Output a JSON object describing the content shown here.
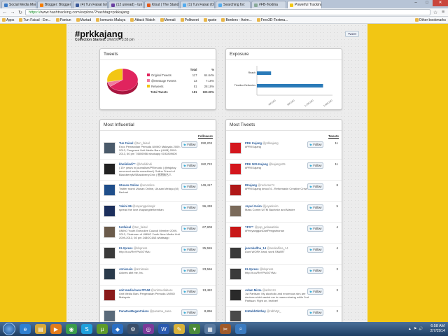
{
  "browser": {
    "tabs": [
      {
        "label": "Social Media Mon",
        "color": "#3b79c4",
        "active": false
      },
      {
        "label": "Blogger: Blogger",
        "color": "#f57d00",
        "active": false
      },
      {
        "label": "(4) Tun Faisal Isma",
        "color": "#3b5998",
        "active": false
      },
      {
        "label": "(12 unread) - tun",
        "color": "#6a3fa0",
        "active": false
      },
      {
        "label": "Klout | The Standa",
        "color": "#e25a1c",
        "active": false
      },
      {
        "label": "(1) Tun Faisal (Or",
        "color": "#55acee",
        "active": false
      },
      {
        "label": "Searching for:",
        "color": "#55acee",
        "active": false
      },
      {
        "label": "#FB-Textma",
        "color": "#8a9",
        "active": false
      },
      {
        "label": "Powerful Tracking",
        "color": "#f2c614",
        "active": true
      }
    ],
    "url_scheme": "https://",
    "url_rest": "www.hashtracking.com/explore/?hashtag=prkkajang",
    "bookmarks": [
      "Apps",
      "Tun Faisal - Em...",
      "Pantun",
      "Murtad",
      "komunis Malaya",
      "Attack Watch",
      "Memali",
      "Politweet",
      "quote",
      "Borders - Anim...",
      "Free3D-Textma..."
    ],
    "other_bookmarks": "Other bookmarks"
  },
  "page": {
    "title": "#prkkajang",
    "collection_label": "Collection Started:",
    "collection_value": "2/6/2014 3:33 pm",
    "tweet_button": "Tweet"
  },
  "tweets_panel": {
    "title": "Tweets",
    "col_total": "Total",
    "col_pct": "%",
    "rows": [
      {
        "label": "Original Tweets",
        "total": "117",
        "pct": "64.64%",
        "color": "#e0245e"
      },
      {
        "label": "@Message Tweets",
        "total": "13",
        "pct": "7.18%",
        "color": "#f07aa0"
      },
      {
        "label": "Retweets",
        "total": "51",
        "pct": "28.18%",
        "color": "#f2c614"
      }
    ],
    "total_label": "Total Tweets",
    "total_value": "181",
    "total_pct": "100.00%"
  },
  "exposure_panel": {
    "title": "Exposure",
    "chart_data": {
      "type": "bar",
      "orientation": "horizontal",
      "categories": [
        "Reach",
        "Timeline Deliveries"
      ],
      "values": [
        300000,
        1400000
      ],
      "tick_labels": [
        "400,000",
        "800,000",
        "1,200,000",
        "1,600,000"
      ],
      "xlim": [
        0,
        1600000
      ],
      "color": "#2a7ab8"
    }
  },
  "influential_panel": {
    "title": "Most Influential",
    "col_label": "Followers",
    "follow_label": "Follow",
    "rows": [
      {
        "name": "Tun Faisal",
        "handle": "@tun_faisal",
        "bio": "Exco Pemandian Pemuda UMNO Malaysia 2009-2013, Pengerusi Unit Media Baru (UMB) 2009-2013, 60 pm 74506956 whatsapp 0192809600",
        "value": "290,203",
        "avatar": "#4a5a6a"
      },
      {
        "name": "kholidindi™",
        "handle": "@kholidindi",
        "bio": "| 15+ years in journalism/PR/music | @rtsjstay servernet media consultant | Online Friend of BlackberryMSBlackberryChix | 香港無名人",
        "value": "182,722",
        "avatar": "#222222"
      },
      {
        "name": "Utusan Online",
        "handle": "@umonline",
        "bio": "Twitter rasmi Utusan Online, Utusan Melayu (M) Berhad",
        "value": "149,417",
        "avatar": "#1f4e8a"
      },
      {
        "name": "Yakini 86",
        "handle": "@sayangpelangir",
        "bio": "spread the love #sayangberkemban",
        "value": "96,438",
        "avatar": "#1c2f5c"
      },
      {
        "name": "tunfaisal",
        "handle": "@tun_faisal",
        "bio": "UMNO Youth Executive Council Member 2009-2013, Chairman of UMNO Youth New Media Unit 2009-2013, 60 pm 248OC4A3 whatsapp 0192809600",
        "value": "67,908",
        "avatar": "#6b5b4b"
      },
      {
        "name": "KLXpress",
        "handle": "@klxpress",
        "bio": "http://t.co/ReYPsOOYMu",
        "value": "25,555",
        "avatar": "#3a3a3a"
      },
      {
        "name": "Aznissain",
        "handle": "@aznissain",
        "bio": "Adores abit me, ha.",
        "value": "23,566",
        "avatar": "#2a3a4a"
      },
      {
        "name": "unit media baru PPUM",
        "handle": "@unitmediabaru",
        "bio": "Unit Media Baru Pergerakan Pemuda UMNO Malaysia",
        "value": "13,482",
        "avatar": "#8a1a1a"
      },
      {
        "name": "PanatouMeganCalare",
        "handle": "@panatou_sana",
        "bio": "",
        "value": "8,896",
        "avatar": "#5a6a7a"
      }
    ]
  },
  "most_tweets_panel": {
    "title": "Most Tweets",
    "col_label": "Tweets",
    "follow_label": "Follow",
    "rows": [
      {
        "name": "PRK Kajang",
        "handle": "@prkkajang",
        "bio": "#PRKKajang",
        "value": "11",
        "avatar": "#d4161d"
      },
      {
        "name": "PRK N25 Kajang",
        "handle": "@kajangn25",
        "bio": "#PRKKajang",
        "value": "11",
        "avatar": "#d4161d"
      },
      {
        "name": "RKajang",
        "handle": "@reclume74",
        "bio": "#PRKKajang #mco74 - Reformasin Creative Crew",
        "value": "8",
        "avatar": "#b01818"
      },
      {
        "name": "Jeyari Keiro",
        "handle": "@jeyarkeiro",
        "bio": "Mass Comm UiTM Bachelor and Master",
        "value": "5",
        "avatar": "#7a6a5a"
      },
      {
        "name": "YPS™",
        "handle": "@yop_pelawatlalu",
        "bio": "#PenyangganDanPengarbonan",
        "value": "4",
        "avatar": "#c81818"
      },
      {
        "name": "jancokalfna_14",
        "handle": "@anokalfina_14",
        "bio": "Dont WORK hard, work SMART",
        "value": "4",
        "avatar": "#3a3a3a"
      },
      {
        "name": "KLXpress",
        "handle": "@klxpress",
        "bio": "http://t.co/ReYPsOOYMu",
        "value": "3",
        "avatar": "#3a3a3a"
      },
      {
        "name": "Adam Mirza",
        "handle": "@adm1z4",
        "bio": "1st Partisan: My alcoholic and enormous strs are devices which assist me to mass-missing while 2nd Partisan: Fight on, brother!",
        "value": "3",
        "avatar": "#2a2a2a"
      },
      {
        "name": "ImRabh0h0hay",
        "handle": "@rabh0yt_",
        "bio": "",
        "value": "3",
        "avatar": "#4a4a4a"
      }
    ]
  },
  "taskbar": {
    "time": "6:58 AM",
    "date": "2/7/2014",
    "apps": [
      {
        "icon": "ie-icon",
        "glyph": "e",
        "color": "#2f80d1"
      },
      {
        "icon": "folder-icon",
        "glyph": "▤",
        "color": "#d8a93a"
      },
      {
        "icon": "media-player-icon",
        "glyph": "▶",
        "color": "#e27b1a"
      },
      {
        "icon": "chrome-icon",
        "glyph": "◉",
        "color": "#3a9d4b"
      },
      {
        "icon": "skype-icon",
        "glyph": "S",
        "color": "#1ea0dc"
      },
      {
        "icon": "utorrent-icon",
        "glyph": "µ",
        "color": "#5d9b2a"
      },
      {
        "icon": "dropbox-icon",
        "glyph": "◆",
        "color": "#2a6fc4"
      },
      {
        "icon": "steam-icon",
        "glyph": "⚙",
        "color": "#3b4f6a"
      },
      {
        "icon": "games-icon",
        "glyph": "◎",
        "color": "#7a3a9a"
      },
      {
        "icon": "word-icon",
        "glyph": "W",
        "color": "#2a5ab0"
      },
      {
        "icon": "paint-icon",
        "glyph": "✎",
        "color": "#d8b23a"
      },
      {
        "icon": "torrent-icon",
        "glyph": "▼",
        "color": "#4a8a3a"
      },
      {
        "icon": "calculator-icon",
        "glyph": "▦",
        "color": "#5a7aa0"
      },
      {
        "icon": "tool-icon",
        "glyph": "✂",
        "color": "#a05a2a"
      },
      {
        "icon": "search-app-icon",
        "glyph": "⌕",
        "color": "#3a7ac0"
      }
    ]
  }
}
